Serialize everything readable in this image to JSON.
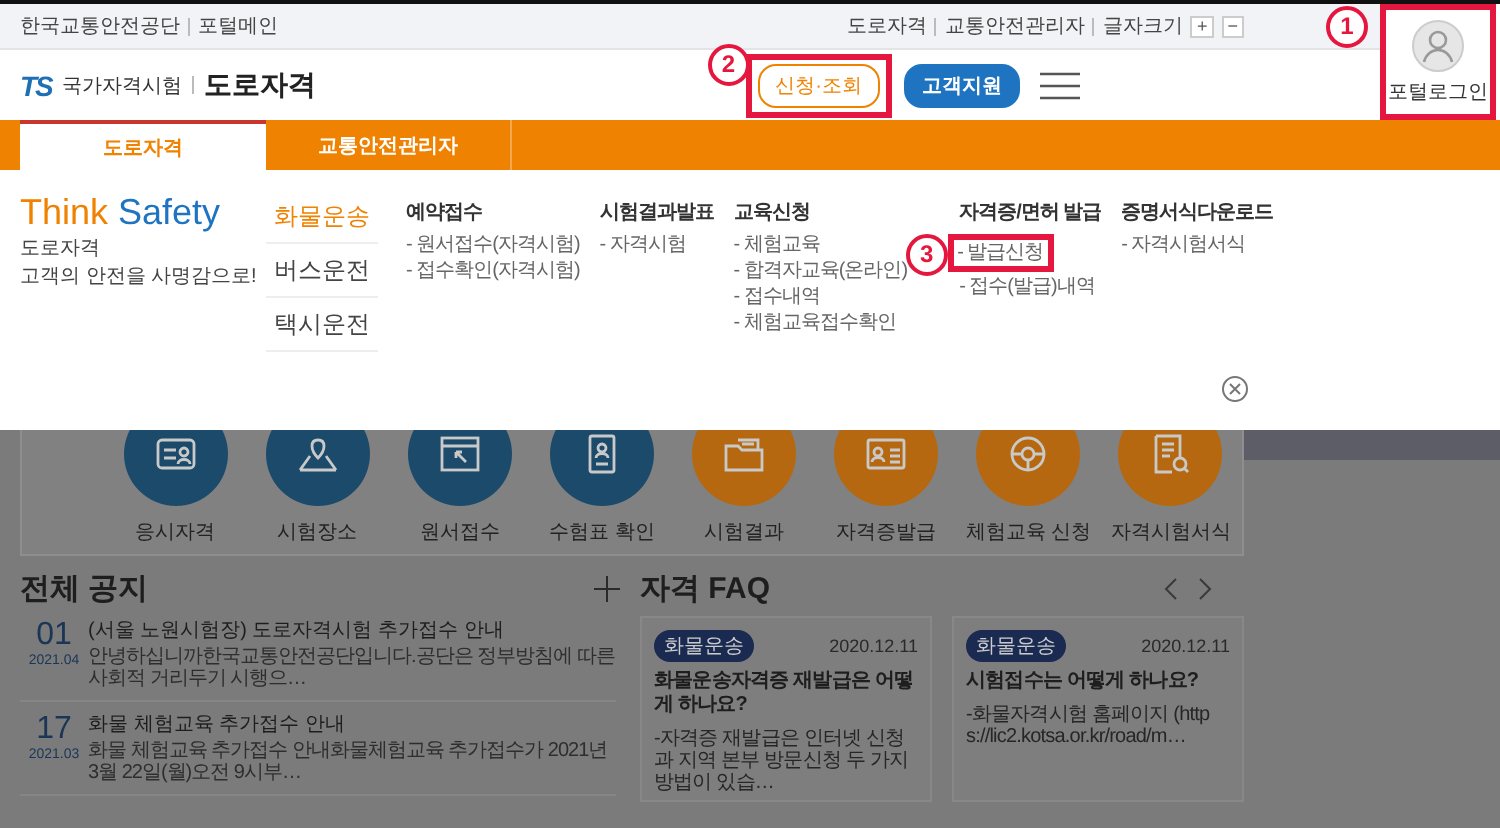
{
  "utility_bar": {
    "left_links": [
      "한국교통안전공단",
      "포털메인"
    ],
    "right_links": [
      "도로자격",
      "교통안전관리자"
    ],
    "font_size": {
      "label": "글자크기",
      "buttons": [
        "+",
        "−"
      ]
    }
  },
  "header": {
    "logo": {
      "mark": "TS",
      "org": "국가자격시험",
      "site": "도로자격"
    },
    "buttons": [
      {
        "label": "신청·조회",
        "kind": "outline",
        "annotation": "2"
      },
      {
        "label": "고객지원",
        "kind": "filled"
      }
    ],
    "portal_login": {
      "label": "포털로그인",
      "annotation": "1"
    }
  },
  "nav_tabs": [
    {
      "label": "도로자격",
      "selected": true
    },
    {
      "label": "교통안전관리자",
      "selected": false
    }
  ],
  "mega_menu": {
    "slogan": {
      "first": "Think",
      "second": "Safety"
    },
    "tagline": [
      "도로자격",
      "고객의 안전을 사명감으로!"
    ],
    "categories": [
      {
        "label": "화물운송",
        "selected": true
      },
      {
        "label": "버스운전",
        "selected": false
      },
      {
        "label": "택시운전",
        "selected": false
      }
    ],
    "columns": [
      {
        "heading": "예약접수",
        "links": [
          {
            "label": "- 원서접수(자격시험)"
          },
          {
            "label": "- 접수확인(자격시험)"
          }
        ]
      },
      {
        "heading": "시험결과발표",
        "links": [
          {
            "label": "- 자격시험"
          }
        ]
      },
      {
        "heading": "교육신청",
        "links": [
          {
            "label": "- 체험교육"
          },
          {
            "label": "- 합격자교육(온라인)"
          },
          {
            "label": "- 접수내역"
          },
          {
            "label": "- 체험교육접수확인"
          }
        ]
      },
      {
        "heading": "자격증/면허 발급",
        "links": [
          {
            "label": "- 발급신청",
            "annotation": "3"
          },
          {
            "label": "- 접수(발급)내역"
          }
        ]
      },
      {
        "heading": "증명서식다운로드",
        "links": [
          {
            "label": "- 자격시험서식"
          }
        ]
      }
    ]
  },
  "quick_links": [
    {
      "label": "응시자격",
      "color": "#1b4a6b"
    },
    {
      "label": "시험장소",
      "color": "#1b4a6b"
    },
    {
      "label": "원서접수",
      "color": "#1b4a6b"
    },
    {
      "label": "수험표 확인",
      "color": "#1b4a6b"
    },
    {
      "label": "시험결과",
      "color": "#b5680f"
    },
    {
      "label": "자격증발급",
      "color": "#b5680f"
    },
    {
      "label": "체험교육 신청",
      "color": "#b5680f"
    },
    {
      "label": "자격시험서식",
      "color": "#b5680f"
    }
  ],
  "notices": {
    "title": "전체 공지",
    "items": [
      {
        "day": "01",
        "month": "2021.04",
        "title": "(서울 노원시험장) 도로자격시험 추가접수 안내",
        "summary": "안녕하십니까한국교통안전공단입니다.공단은 정부방침에 따른 사회적 거리두기 시행으…"
      },
      {
        "day": "17",
        "month": "2021.03",
        "title": "화물 체험교육 추가접수 안내",
        "summary": "화물 체험교육 추가접수 안내화물체험교육 추가접수가 2021년 3월 22일(월)오전 9시부…"
      }
    ]
  },
  "faq": {
    "title": "자격 FAQ",
    "cards": [
      {
        "tag": "화물운송",
        "date": "2020.12.11",
        "question": "화물운송자격증 재발급은 어떻게 하나요?",
        "answer": "-자격증 재발급은 인터넷 신청과 지역 본부 방문신청 두 가지 방법이 있습…"
      },
      {
        "tag": "화물운송",
        "date": "2020.12.11",
        "question": "시험접수는 어떻게 하나요?",
        "answer": "-화물자격시험 홈페이지 (https://lic2.kotsa.or.kr/road/m…"
      }
    ]
  }
}
